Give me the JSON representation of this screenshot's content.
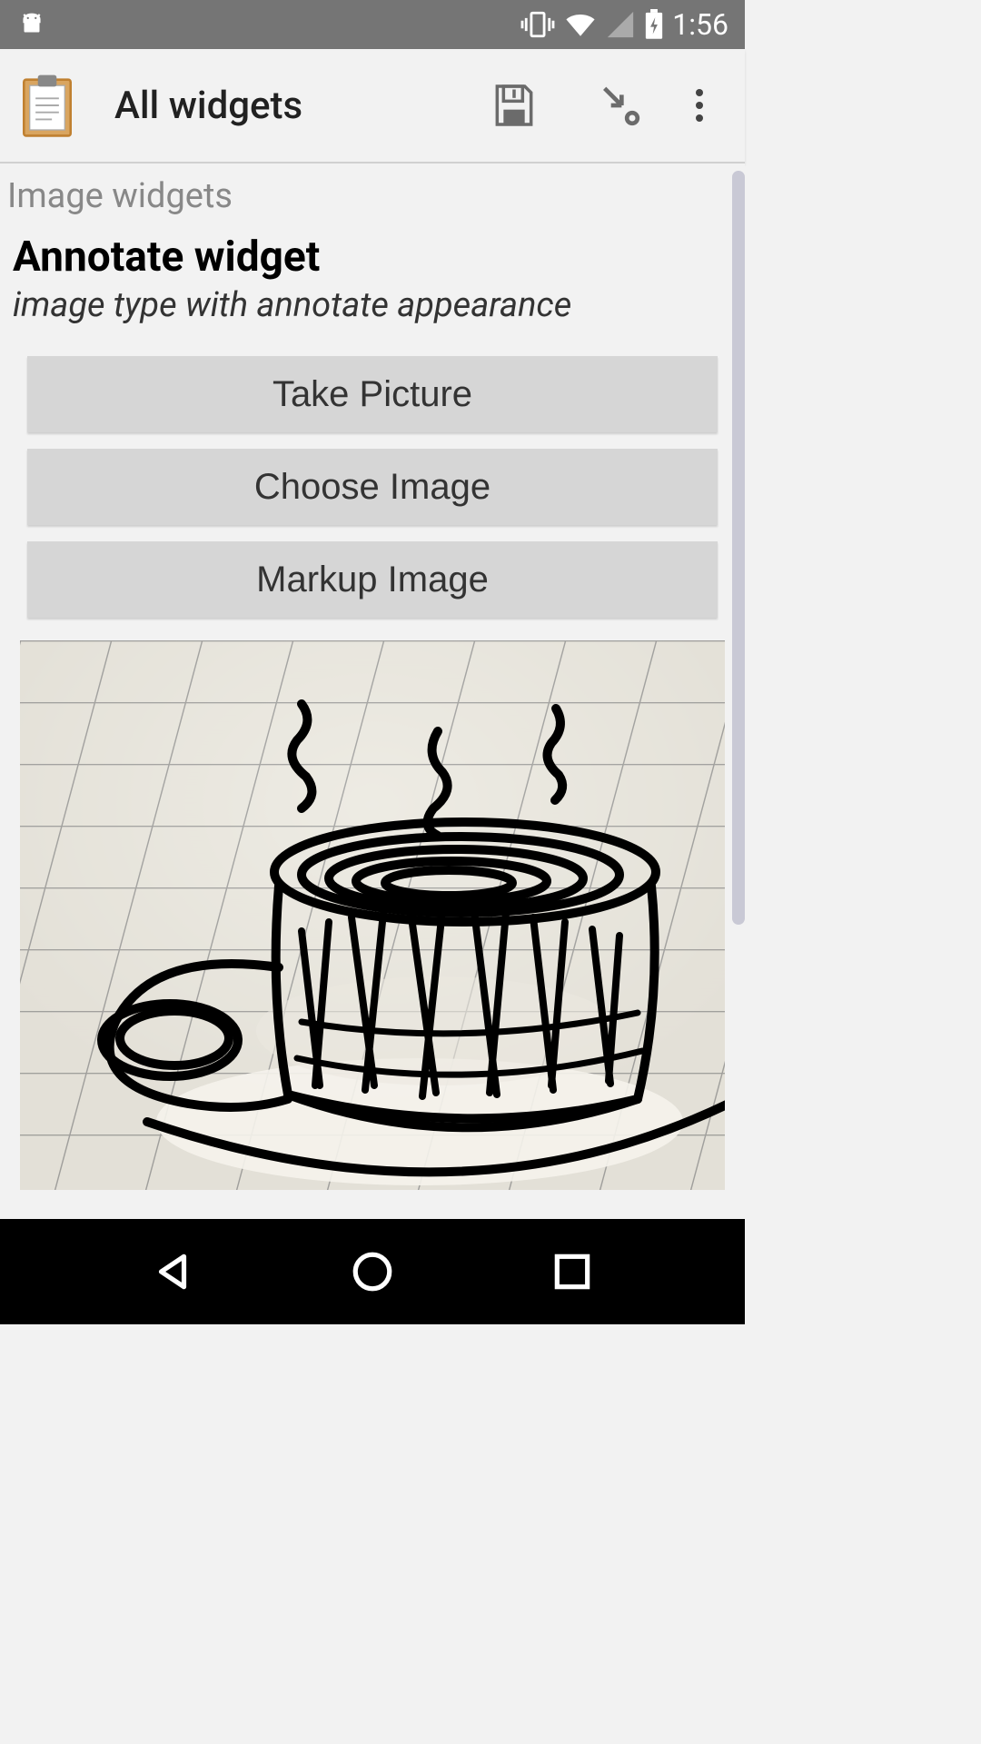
{
  "status": {
    "time": "1:56"
  },
  "appBar": {
    "title": "All widgets"
  },
  "content": {
    "sectionHeader": "Image widgets",
    "widgetTitle": "Annotate widget",
    "widgetSubtitle": "image type with annotate appearance",
    "buttons": {
      "takePicture": "Take Picture",
      "chooseImage": "Choose Image",
      "markupImage": "Markup Image"
    }
  }
}
